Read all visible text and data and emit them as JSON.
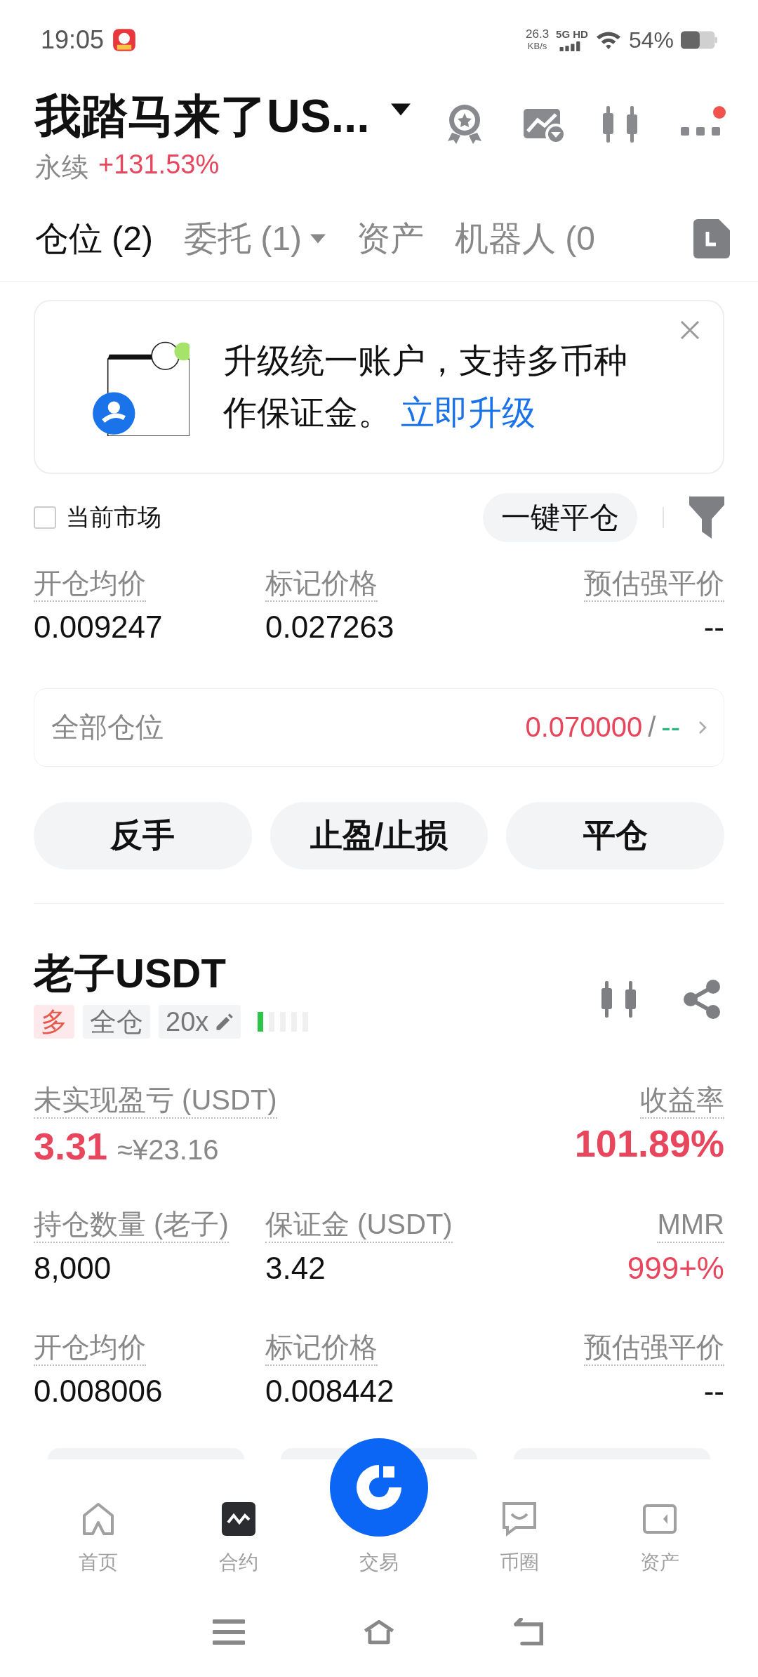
{
  "status_bar": {
    "time": "19:05",
    "net_speed": "26.3",
    "net_unit": "KB/s",
    "network": "5G HD",
    "battery": "54%"
  },
  "header": {
    "title": "我踏马来了US...",
    "type": "永续",
    "change": "+131.53%",
    "has_notification": true
  },
  "tabs": [
    {
      "label": "仓位 (2)",
      "selected": true,
      "dropdown": false
    },
    {
      "label": "委托 (1)",
      "selected": false,
      "dropdown": true
    },
    {
      "label": "资产",
      "selected": false,
      "dropdown": false
    },
    {
      "label": "机器人 (0",
      "selected": false,
      "dropdown": false
    }
  ],
  "banner": {
    "text": "升级统一账户，支持多币种作保证金。",
    "link": "立即升级"
  },
  "filter": {
    "label": "当前市场",
    "checked": false,
    "close_all": "一键平仓"
  },
  "summary": {
    "fields": [
      {
        "label": "开仓均价",
        "value": "0.009247"
      },
      {
        "label": "标记价格",
        "value": "0.027263"
      },
      {
        "label": "预估强平价",
        "value": "--"
      }
    ],
    "all_positions": {
      "label": "全部仓位",
      "value": "0.070000",
      "separator": "/",
      "value2": "--"
    },
    "actions": [
      "反手",
      "止盈/止损",
      "平仓"
    ]
  },
  "position": {
    "symbol": "老子USDT",
    "tags": [
      {
        "label": "多",
        "kind": "side"
      },
      {
        "label": "全仓",
        "kind": "plain"
      },
      {
        "label": "20x",
        "kind": "leverage"
      }
    ],
    "adl": {
      "level": 0.2
    },
    "pnl": {
      "label": "未实现盈亏 (USDT)",
      "value": "3.31",
      "approx": "≈¥23.16"
    },
    "roe": {
      "label": "收益率",
      "value": "101.89%"
    },
    "rows": [
      [
        {
          "label": "持仓数量 (老子)",
          "value": "8,000",
          "highlighted": false
        },
        {
          "label": "保证金 (USDT)",
          "value": "3.42",
          "highlighted": false
        },
        {
          "label": "MMR",
          "value": "999+%",
          "highlighted": true
        }
      ],
      [
        {
          "label": "开仓均价",
          "value": "0.008006",
          "highlighted": false
        },
        {
          "label": "标记价格",
          "value": "0.008442",
          "highlighted": false
        },
        {
          "label": "预估强平价",
          "value": "--",
          "highlighted": false
        }
      ]
    ]
  },
  "bottom_nav": [
    {
      "label": "首页",
      "selected": false,
      "kind": "home"
    },
    {
      "label": "合约",
      "selected": true,
      "kind": "futures"
    },
    {
      "label": "交易",
      "selected": false,
      "kind": "trade"
    },
    {
      "label": "币圈",
      "selected": false,
      "kind": "chat"
    },
    {
      "label": "资产",
      "selected": false,
      "kind": "wallet"
    }
  ]
}
